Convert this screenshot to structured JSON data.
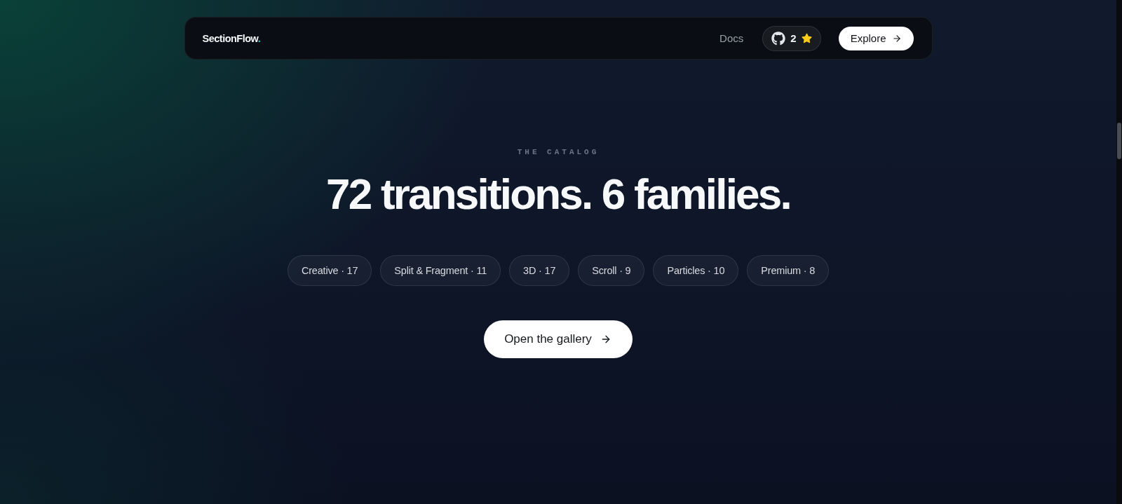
{
  "navbar": {
    "logo": {
      "text": "SectionFlow",
      "accent": "."
    },
    "links": [
      {
        "label": "Docs"
      }
    ],
    "github": {
      "count": "2"
    },
    "cta": {
      "label": "Explore"
    }
  },
  "hero": {
    "eyebrow": "THE CATALOG",
    "heading": "72 transitions. 6 families.",
    "families": [
      {
        "label": "Creative · 17"
      },
      {
        "label": "Split & Fragment · 11"
      },
      {
        "label": "3D · 17"
      },
      {
        "label": "Scroll · 9"
      },
      {
        "label": "Particles · 10"
      },
      {
        "label": "Premium · 8"
      }
    ],
    "button": {
      "label": "Open the gallery"
    }
  }
}
